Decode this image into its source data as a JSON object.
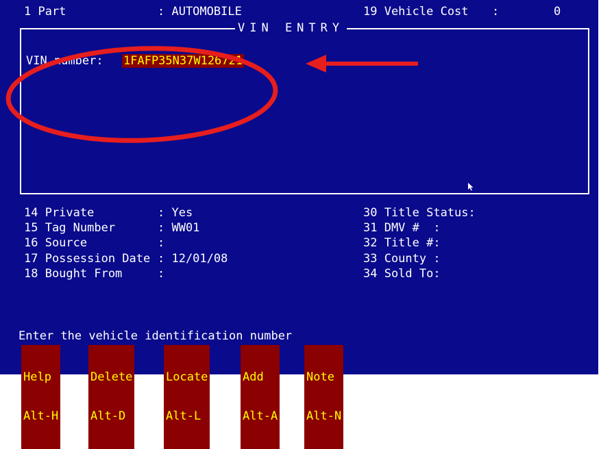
{
  "header": {
    "left_field": "1 Part",
    "left_value": ": AUTOMOBILE",
    "right_field": "19 Vehicle Cost",
    "right_colon": ":",
    "right_value": "0"
  },
  "vin_box": {
    "title": "VIN ENTRY",
    "label": "VIN number:",
    "value": "1FAFP35N37W126721"
  },
  "fields_left": [
    {
      "label": "14 Private",
      "value": ": Yes"
    },
    {
      "label": "15 Tag Number",
      "value": ": WW01"
    },
    {
      "label": "16 Source",
      "value": ":"
    },
    {
      "label": "17 Possession Date",
      "value": ": 12/01/08"
    },
    {
      "label": "18 Bought From",
      "value": ":"
    }
  ],
  "fields_right": [
    {
      "label": "30 Title Status:"
    },
    {
      "label": "31 DMV #  :"
    },
    {
      "label": "32 Title #:"
    },
    {
      "label": "33 County :"
    },
    {
      "label": "34 Sold To:"
    }
  ],
  "status_line": "Enter the vehicle identification number",
  "function_keys": [
    {
      "name": "Help",
      "key": "Alt-H"
    },
    {
      "name": "Delete",
      "key": "Alt-D"
    },
    {
      "name": "Locate",
      "key": "Alt-L"
    },
    {
      "name": "Add",
      "key": "Alt-A"
    },
    {
      "name": "Note",
      "key": "Alt-N"
    }
  ],
  "annotation": {
    "color": "#e61e1e"
  },
  "colors": {
    "background": "#0a0a8c",
    "text": "#ffffff",
    "highlight_bg": "#8b0000",
    "highlight_text": "#ffff00"
  }
}
